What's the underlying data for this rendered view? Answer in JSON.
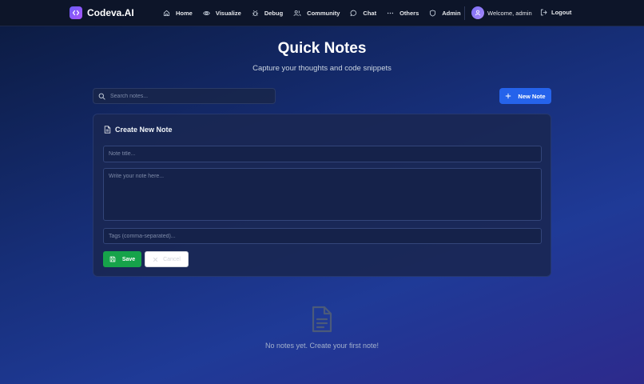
{
  "brand": {
    "name": "Codeva.AI"
  },
  "nav": {
    "items": [
      {
        "label": "Home",
        "icon": "home-icon"
      },
      {
        "label": "Visualize",
        "icon": "eye-icon"
      },
      {
        "label": "Debug",
        "icon": "bug-icon"
      },
      {
        "label": "Community",
        "icon": "users-icon"
      },
      {
        "label": "Chat",
        "icon": "chat-icon"
      },
      {
        "label": "Others",
        "icon": "more-icon"
      },
      {
        "label": "Admin",
        "icon": "shield-icon"
      }
    ],
    "welcome": "Welcome, admin",
    "logout": "Logout"
  },
  "header": {
    "title": "Quick Notes",
    "subtitle": "Capture your thoughts and code snippets"
  },
  "search": {
    "placeholder": "Search notes..."
  },
  "new_note_label": "New Note",
  "create_form": {
    "title": "Create New Note",
    "title_placeholder": "Note title...",
    "body_placeholder": "Write your note here...",
    "tags_placeholder": "Tags (comma-separated)...",
    "save_label": "Save",
    "cancel_label": "Cancel"
  },
  "empty_state": {
    "message": "No notes yet. Create your first note!"
  },
  "colors": {
    "primary": "#2563eb",
    "success": "#16a34a",
    "brand": "#7c5cf6"
  }
}
